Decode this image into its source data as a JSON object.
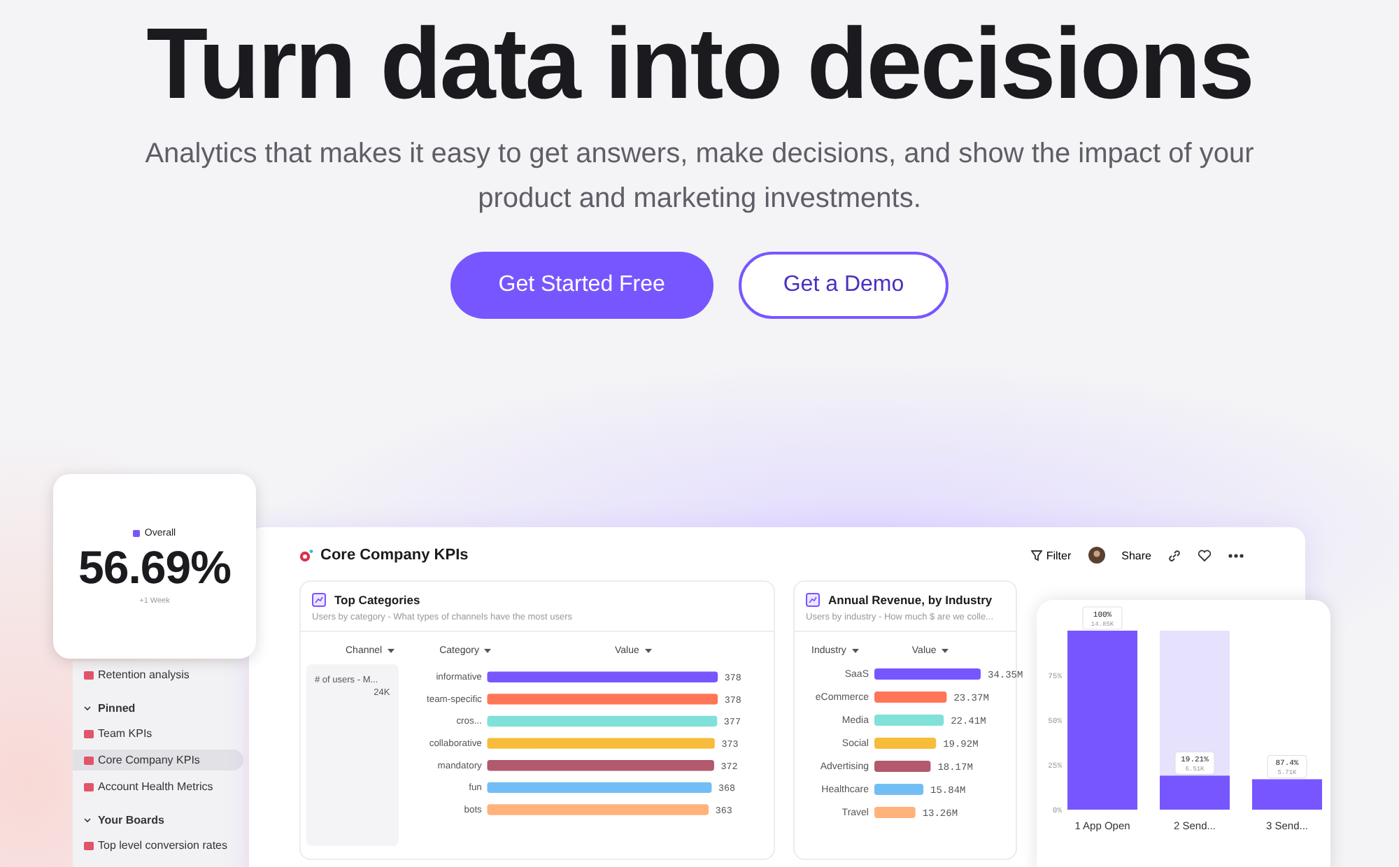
{
  "hero": {
    "title": "Turn data into decisions",
    "subtitle": "Analytics that makes it easy to get answers, make decisions, and show the impact of your product and marketing investments.",
    "buttons": [
      {
        "label": "Get Started Free",
        "kind": "primary"
      },
      {
        "label": "Get a Demo",
        "kind": "secondary"
      }
    ]
  },
  "overall_card": {
    "label": "Overall",
    "value": "56.69%",
    "period": "+1 Week"
  },
  "sidebar": {
    "items": [
      {
        "label": "Retention analysis",
        "selected": false
      }
    ],
    "sections": [
      {
        "label": "Pinned",
        "expanded": true,
        "items": [
          {
            "label": "Team KPIs",
            "selected": false
          },
          {
            "label": "Core Company KPIs",
            "selected": true
          },
          {
            "label": "Account Health Metrics",
            "selected": false
          }
        ]
      },
      {
        "label": "Your Boards",
        "expanded": true,
        "items": [
          {
            "label": "Top level conversion rates",
            "selected": false
          }
        ]
      }
    ]
  },
  "dashboard": {
    "title": "Core Company KPIs",
    "toolbar": [
      {
        "kind": "filter",
        "label": "Filter"
      },
      {
        "kind": "avatar"
      },
      {
        "kind": "share",
        "label": "Share"
      },
      {
        "kind": "link"
      },
      {
        "kind": "heart"
      },
      {
        "kind": "more"
      }
    ],
    "top_categories": {
      "title": "Top Categories",
      "subtitle": "Users by category - What types of channels have the most users",
      "columns": [
        "Channel",
        "Category",
        "Value"
      ],
      "channel": {
        "label": "# of users - M...",
        "count": "24K"
      },
      "chart_data": {
        "type": "bar",
        "orientation": "horizontal",
        "categories": [
          "informative",
          "team-specific",
          "cros...",
          "collaborative",
          "mandatory",
          "fun",
          "bots"
        ],
        "values": [
          378,
          378,
          377,
          373,
          372,
          368,
          363
        ],
        "data_labels": true
      }
    },
    "revenue": {
      "title": "Annual Revenue, by Industry",
      "subtitle": "Users by industry - How much $ are we colle...",
      "columns": [
        "Industry",
        "Value"
      ],
      "chart_data": {
        "type": "bar",
        "orientation": "horizontal",
        "categories": [
          "SaaS",
          "eCommerce",
          "Media",
          "Social",
          "Advertising",
          "Healthcare",
          "Travel"
        ],
        "values": [
          34.35,
          23.37,
          22.41,
          19.92,
          18.17,
          15.84,
          13.26
        ],
        "value_labels": [
          "34.35M",
          "23.37M",
          "22.41M",
          "19.92M",
          "18.17M",
          "15.84M",
          "13.26M"
        ]
      }
    }
  },
  "funnel": {
    "chart_data": {
      "type": "bar",
      "categories": [
        "1 App Open",
        "2 Send...",
        "3 Send..."
      ],
      "values": [
        100,
        19,
        17
      ],
      "ylim": [
        0,
        100
      ],
      "yticks": [
        {
          "value": 0,
          "label": "0%"
        },
        {
          "value": 25,
          "label": "25%"
        },
        {
          "value": 50,
          "label": "50%"
        },
        {
          "value": 75,
          "label": "75%"
        }
      ],
      "annotations": [
        {
          "x": "1 App Open",
          "y": 100,
          "text": "100%"
        },
        {
          "x": "2 Send...",
          "y": 19,
          "text": "19.21%"
        },
        {
          "x": "3 Send...",
          "y": 17,
          "text": "87.4%"
        }
      ]
    },
    "counts": [
      "14.85K",
      "6.51K",
      "5.71K"
    ]
  }
}
